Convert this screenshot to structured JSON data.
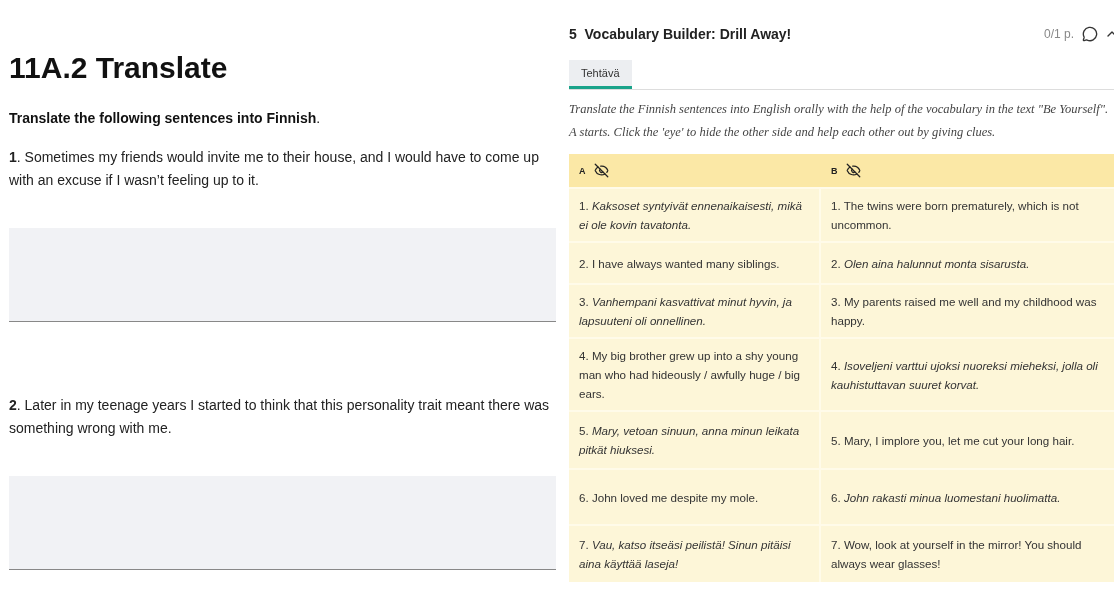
{
  "assignment": {
    "title": "11A.2 Translate",
    "instruction": "**Translate the following sentences into Finnish**.",
    "questions": [
      {
        "text": "**1**. Sometimes my friends would invite me to their house, and I would have to come up with an excuse if I wasn’t feeling up to it."
      },
      {
        "text": "**2**. Later in my teenage years I started to think that this personality trait meant there was something wrong with me."
      }
    ]
  },
  "exercise": {
    "number": "5",
    "title": "Vocabulary Builder: Drill Away!",
    "score": "0/1 p.",
    "tabs": [
      {
        "label": "Tehtävä",
        "selected": true
      }
    ],
    "instruction": "Translate the Finnish sentences into English orally with the help of the vocabulary in the text \"Be Yourself\". A starts. Click the 'eye' to hide the other side and help each other out by giving clues.",
    "table": {
      "columns": [
        "A",
        "B"
      ],
      "rows": [
        [
          "1. *Kaksoset syntyivät ennenaikaisesti, mikä ei ole kovin tavatonta.*",
          "1. The twins were born prematurely, which is not uncommon."
        ],
        [
          "2. I have always wanted many siblings.",
          "2. *Olen aina halunnut monta sisarusta.*"
        ],
        [
          "3. *Vanhempani kasvattivat minut hyvin, ja lapsuuteni oli onnellinen.*",
          "3. My parents raised me well and my childhood was happy."
        ],
        [
          "4. My big brother grew up into a shy young man who had hideously / awfully huge / big ears.",
          "4. *Isoveljeni varttui ujoksi nuoreksi mieheksi, jolla oli kauhistuttavan suuret korvat.*"
        ],
        [
          "5. *Mary, vetoan sinuun, anna minun leikata pitkät hiuksesi.*",
          "5. Mary, I implore you, let me cut your long hair."
        ],
        [
          "6. John loved me despite my mole.",
          "6. *John rakasti minua luomestani huolimatta.*"
        ],
        [
          "7. *Vau, katso itseäsi peilistä! Sinun pitäisi aina käyttää laseja!*",
          "7. Wow, look at yourself in the mirror! You should always wear glasses!"
        ]
      ]
    }
  }
}
